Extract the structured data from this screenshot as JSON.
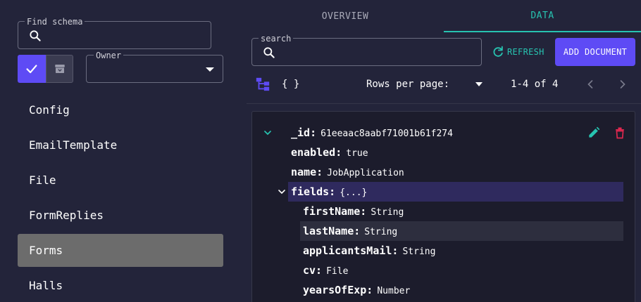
{
  "sidebar": {
    "find_label": "Find schema",
    "owner_label": "Owner",
    "schemas": [
      {
        "label": "Config"
      },
      {
        "label": "EmailTemplate"
      },
      {
        "label": "File"
      },
      {
        "label": "FormReplies"
      },
      {
        "label": "Forms",
        "active": true
      },
      {
        "label": "Halls"
      }
    ]
  },
  "tabs": {
    "overview": "OVERVIEW",
    "data": "DATA",
    "active": "DATA"
  },
  "toolbar": {
    "search_label": "search",
    "refresh_label": "REFRESH",
    "add_label": "ADD DOCUMENT",
    "json_icon_text": "{ }",
    "rows_per_page_label": "Rows per page:",
    "range_label": "1-4 of 4"
  },
  "document": {
    "id_key": "_id:",
    "id_value": "61eeaac8aabf71001b61f274",
    "enabled_key": "enabled:",
    "enabled_value": "true",
    "name_key": "name:",
    "name_value": "JobApplication",
    "fields_key": "fields:",
    "fields_value": "{...}",
    "fields": [
      {
        "key": "firstName:",
        "value": "String"
      },
      {
        "key": "lastName:",
        "value": "String"
      },
      {
        "key": "applicantsMail:",
        "value": "String"
      },
      {
        "key": "cv:",
        "value": "File"
      },
      {
        "key": "yearsOfExp:",
        "value": "Number"
      }
    ]
  },
  "colors": {
    "accent": "#5e4bf5",
    "teal": "#27c3b0",
    "danger": "#e0284f",
    "background": "#23243a"
  }
}
